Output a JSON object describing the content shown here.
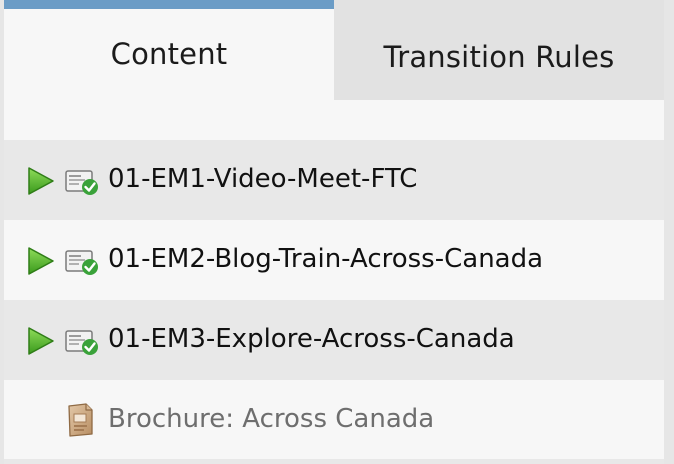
{
  "tabs": [
    {
      "label": "Content",
      "active": true
    },
    {
      "label": "Transition Rules",
      "active": false
    }
  ],
  "items": [
    {
      "type": "email",
      "label": "01-EM1-Video-Meet-FTC",
      "icon": "email-approved-icon",
      "has_play": true
    },
    {
      "type": "email",
      "label": "01-EM2-Blog-Train-Across-Canada",
      "icon": "email-approved-icon",
      "has_play": true
    },
    {
      "type": "email",
      "label": "01-EM3-Explore-Across-Canada",
      "icon": "email-approved-icon",
      "has_play": true
    },
    {
      "type": "file",
      "label": "Brochure: Across Canada",
      "icon": "brochure-file-icon",
      "has_play": false
    }
  ],
  "colors": {
    "tab_accent": "#6b9cc6",
    "play_green": "#4caf2a",
    "check_green": "#3aa23a"
  }
}
